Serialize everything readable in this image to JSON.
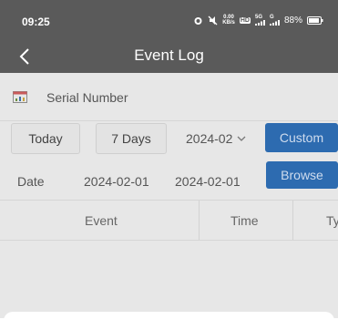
{
  "status_bar": {
    "time": "09:25",
    "net_speed_top": "0.00",
    "net_speed_bottom": "KB/s",
    "hd_label": "HD",
    "signal_5g": "5G",
    "signal_g": "G",
    "battery": "88%"
  },
  "header": {
    "title": "Event Log"
  },
  "serial": {
    "label": "Serial Number"
  },
  "filters": {
    "today": "Today",
    "seven_days": "7 Days",
    "month": "2024-02",
    "custom": "Custom"
  },
  "date_range": {
    "label": "Date",
    "start": "2024-02-01",
    "end": "2024-02-01",
    "browse": "Browse"
  },
  "table": {
    "columns": [
      "Event",
      "Time",
      "Ty"
    ]
  },
  "colors": {
    "header_bg": "#5a5a5a",
    "accent_blue": "#2d6bb0",
    "overlay": "#e7e7e7"
  }
}
